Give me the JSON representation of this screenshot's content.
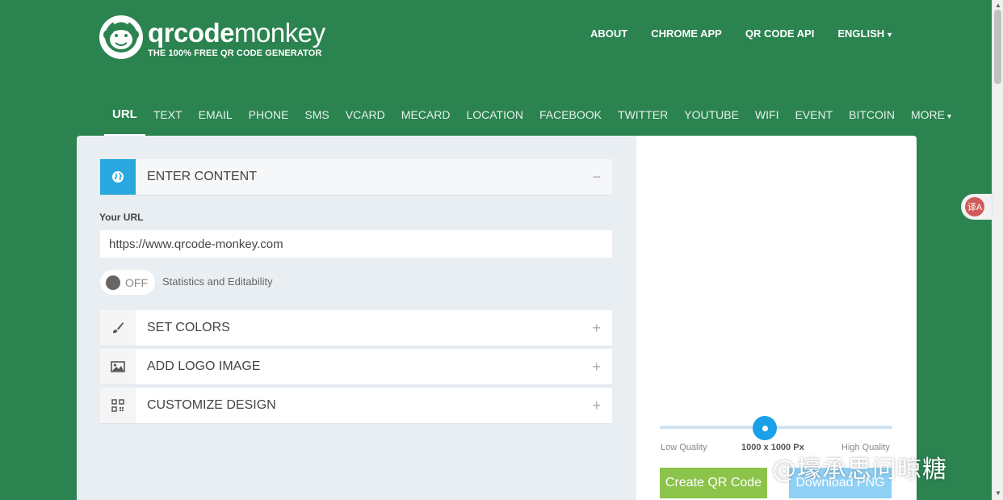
{
  "brand": {
    "name_bold": "qrcode",
    "name_light": "monkey",
    "tagline": "THE 100% FREE QR CODE GENERATOR"
  },
  "topnav": {
    "about": "ABOUT",
    "chrome_app": "CHROME APP",
    "api": "QR CODE API",
    "language": "ENGLISH"
  },
  "types": {
    "url": "URL",
    "text": "TEXT",
    "email": "EMAIL",
    "phone": "PHONE",
    "sms": "SMS",
    "vcard": "VCARD",
    "mecard": "MECARD",
    "location": "LOCATION",
    "facebook": "FACEBOOK",
    "twitter": "TWITTER",
    "youtube": "YOUTUBE",
    "wifi": "WIFI",
    "event": "EVENT",
    "bitcoin": "BITCOIN",
    "more": "MORE"
  },
  "sections": {
    "content": {
      "label": "ENTER CONTENT",
      "state": "−"
    },
    "colors": {
      "label": "SET COLORS",
      "state": "+"
    },
    "logo": {
      "label": "ADD LOGO IMAGE",
      "state": "+"
    },
    "design": {
      "label": "CUSTOMIZE DESIGN",
      "state": "+"
    }
  },
  "url_field": {
    "label": "Your URL",
    "value": "https://www.qrcode-monkey.com"
  },
  "stats_toggle": {
    "state": "OFF",
    "caption": "Statistics and Editability"
  },
  "quality": {
    "low": "Low Quality",
    "current": "1000 x 1000 Px",
    "high": "High Quality",
    "level": 0.45
  },
  "actions": {
    "create": "Create QR Code",
    "download": "Download PNG"
  },
  "translate_icon": "译A",
  "watermark": "@壕承思问晾糖",
  "colors": {
    "background": "#2b8350",
    "accent": "#29a8e0",
    "create": "#8cc34a",
    "download": "#8fd0f5"
  }
}
